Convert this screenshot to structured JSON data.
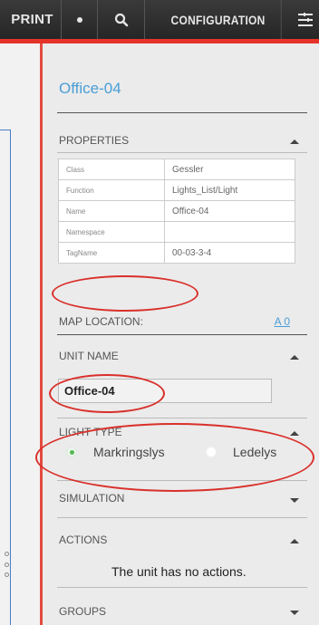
{
  "toolbar": {
    "print_label": "PRINT",
    "configuration_label": "CONFIGURATION",
    "icons": [
      "dot-icon",
      "search-icon",
      "menu-icon"
    ],
    "accent_color": "#e5332a"
  },
  "object_title": "Office-04",
  "properties": {
    "header": "PROPERTIES",
    "rows": [
      {
        "key": "Class",
        "value": "Gessler"
      },
      {
        "key": "Function",
        "value": "Lights_List/Light"
      },
      {
        "key": "Name",
        "value": "Office-04"
      },
      {
        "key": "Namespace",
        "value": ""
      },
      {
        "key": "TagName",
        "value": "00-03-3-4"
      }
    ]
  },
  "map_location": {
    "label": "MAP LOCATION:",
    "link": "A 0"
  },
  "unit_name": {
    "header": "UNIT NAME",
    "value": "Office-04"
  },
  "light_type": {
    "header": "LIGHT TYPE",
    "options": [
      {
        "label": "Markringslys",
        "selected": true
      },
      {
        "label": "Ledelys",
        "selected": false
      }
    ]
  },
  "simulation": {
    "header": "SIMULATION"
  },
  "actions": {
    "header": "ACTIONS",
    "message": "The unit has no actions."
  },
  "groups": {
    "header": "GROUPS"
  },
  "colors": {
    "title_blue": "#4a9ed6",
    "annotation_red": "#d9302b",
    "radio_green": "#58b858"
  }
}
